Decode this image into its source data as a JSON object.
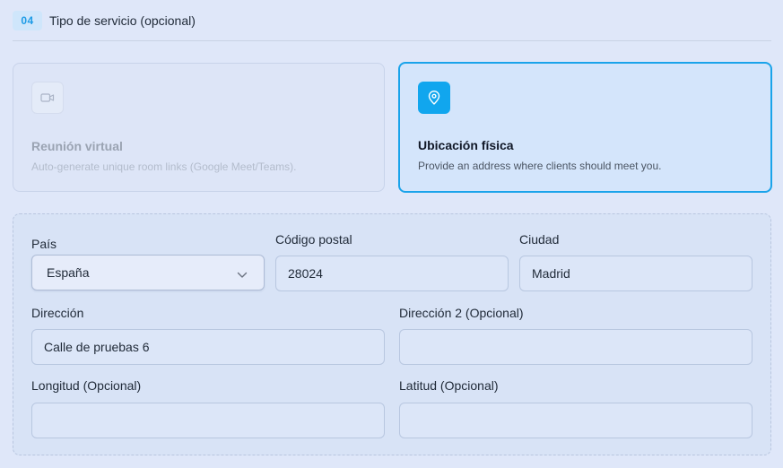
{
  "section": {
    "step": "04",
    "title": "Tipo de servicio (opcional)"
  },
  "options": [
    {
      "title": "Reunión virtual",
      "description": "Auto-generate unique room links (Google Meet/Teams).",
      "icon": "video-camera-icon",
      "selected": false
    },
    {
      "title": "Ubicación física",
      "description": "Provide an address where clients should meet you.",
      "icon": "map-pin-icon",
      "selected": true
    }
  ],
  "address": {
    "country": {
      "label": "País",
      "value": "España"
    },
    "postal_code": {
      "label": "Código postal",
      "value": "28024"
    },
    "city": {
      "label": "Ciudad",
      "value": "Madrid"
    },
    "address1": {
      "label": "Dirección",
      "value": "Calle de pruebas 6"
    },
    "address2": {
      "label": "Dirección 2 (Opcional)",
      "value": ""
    },
    "longitude": {
      "label": "Longitud (Opcional)",
      "value": ""
    },
    "latitude": {
      "label": "Latitud (Opcional)",
      "value": ""
    }
  },
  "colors": {
    "accent": "#11a6ee",
    "background": "#dfe7f9"
  }
}
